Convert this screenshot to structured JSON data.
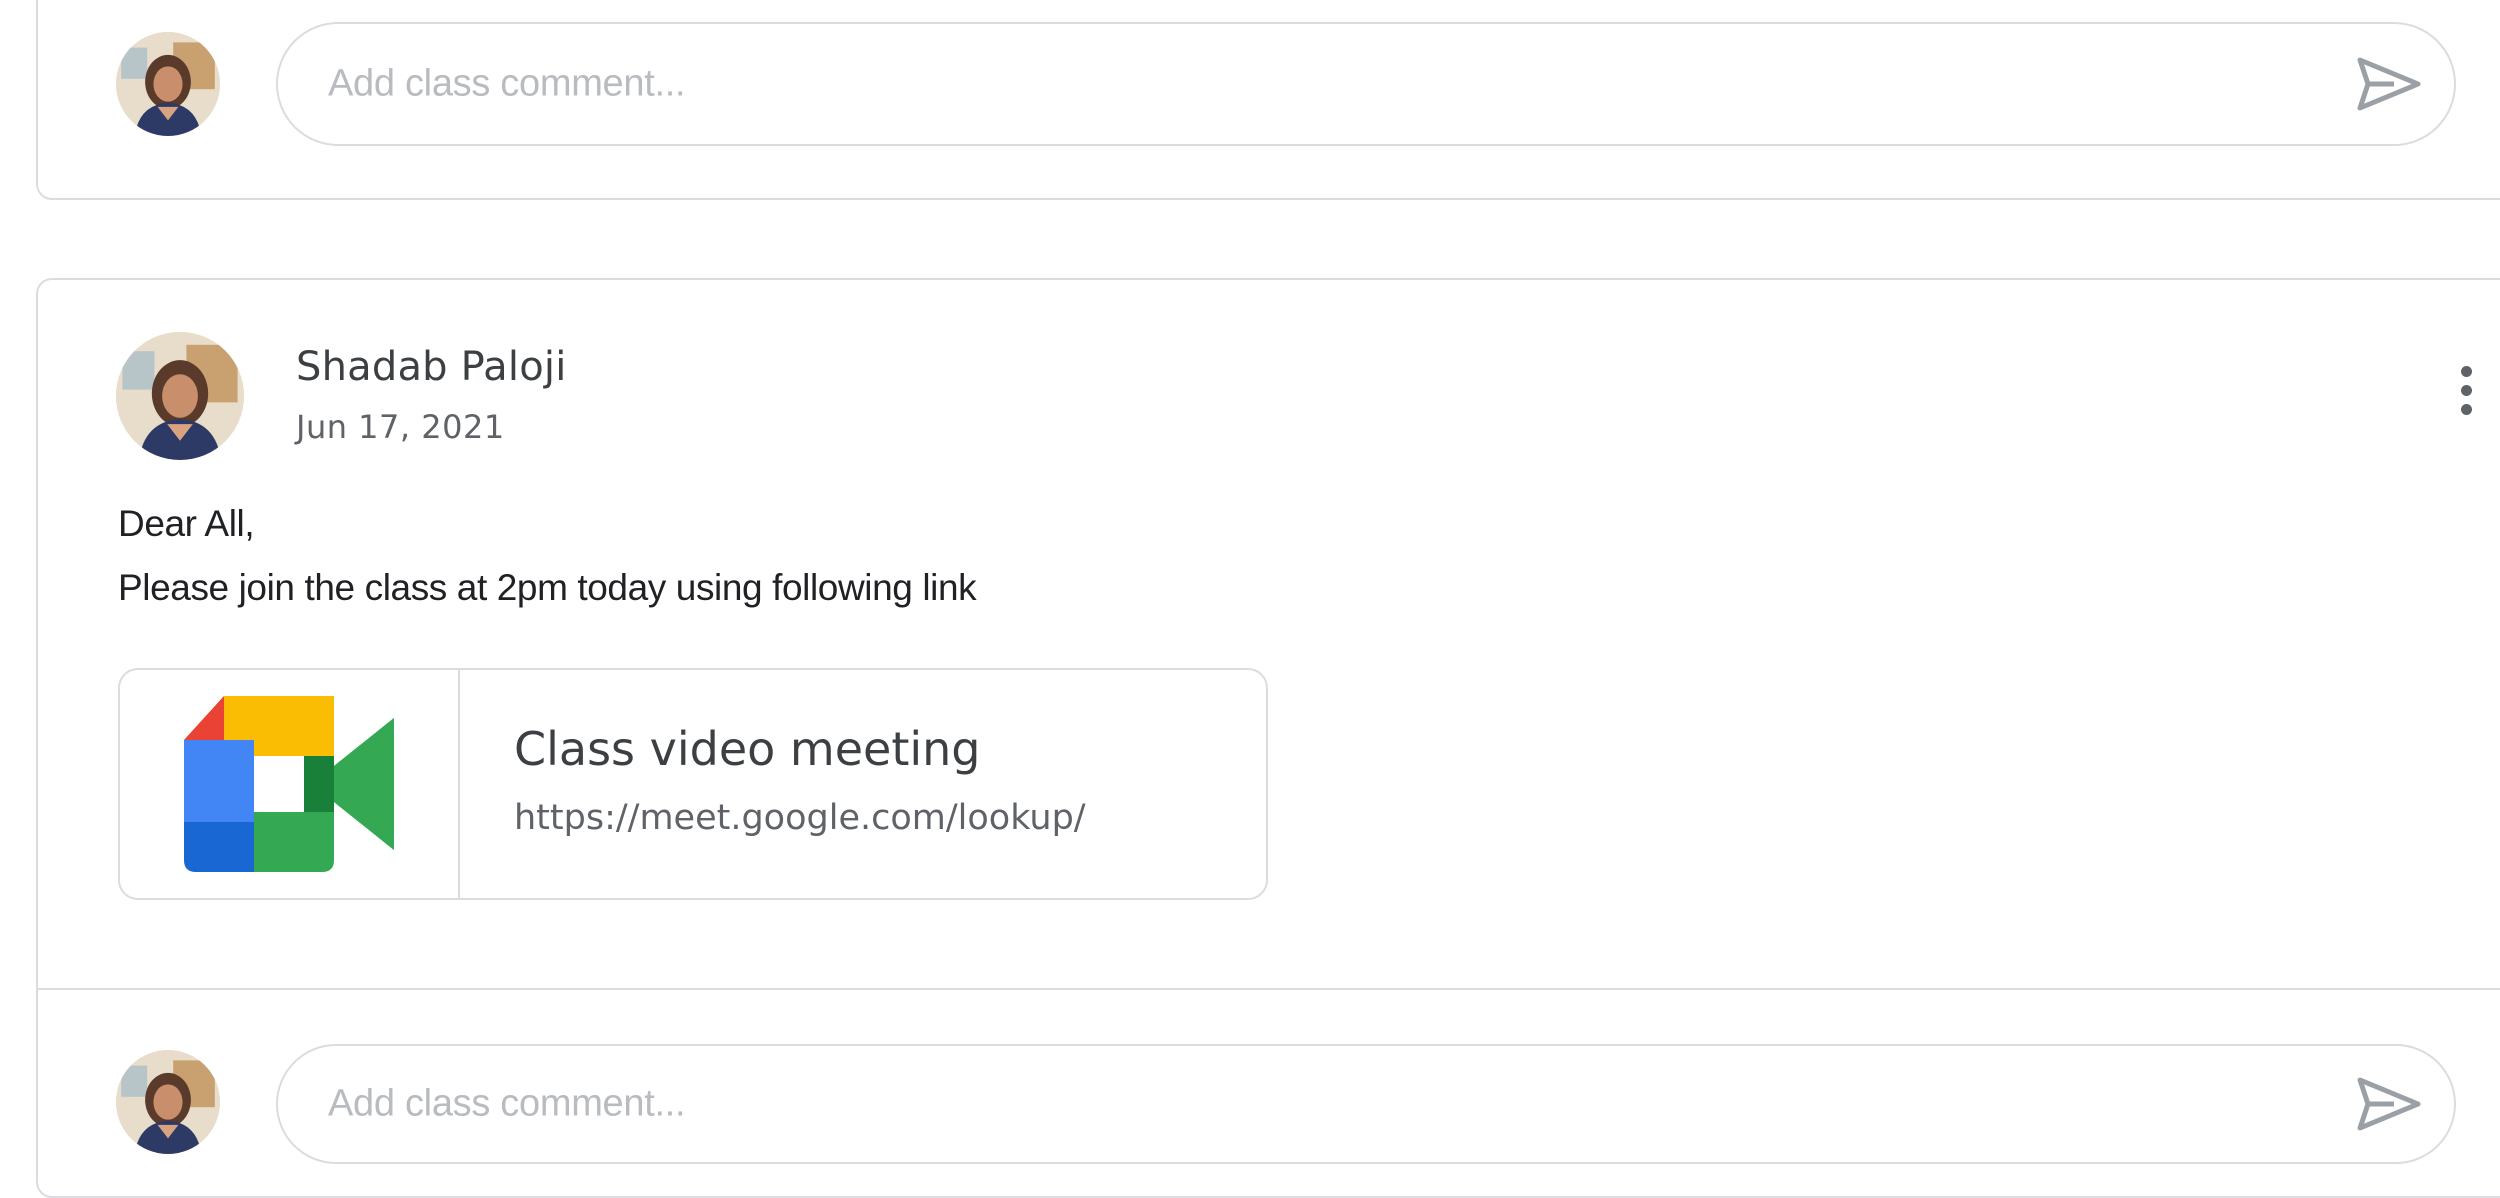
{
  "top_comment": {
    "placeholder": "Add class comment..."
  },
  "post": {
    "author": "Shadab Paloji",
    "date": "Jun 17, 2021",
    "body_lines": [
      "Dear All,",
      "Please join the class at 2pm today using following link"
    ],
    "attachment": {
      "title": "Class video meeting",
      "url": "https://meet.google.com/lookup/",
      "icon": "google-meet-icon"
    },
    "more_icon": "more-vert-icon",
    "comment_placeholder": "Add class comment..."
  },
  "icons": {
    "send": "send-icon",
    "avatar": "avatar"
  },
  "colors": {
    "border": "#dadce0",
    "meet_blue": "#4285f4",
    "meet_green": "#34a853",
    "meet_yellow": "#fbbc04",
    "meet_red": "#ea4335"
  }
}
